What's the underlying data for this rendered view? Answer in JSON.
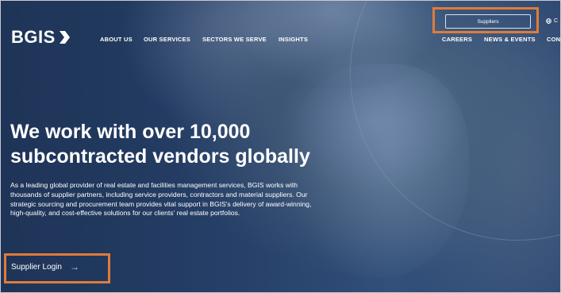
{
  "brand": {
    "logo_text": "BGIS"
  },
  "nav": {
    "items": [
      "ABOUT US",
      "OUR SERVICES",
      "SECTORS WE SERVE",
      "INSIGHTS"
    ]
  },
  "utility_nav": {
    "items": [
      "CAREERS",
      "NEWS & EVENTS",
      "CON"
    ]
  },
  "top_bar": {
    "suppliers_label": "Suppliers",
    "language_label": "C"
  },
  "hero": {
    "headline_line1": "We work with over 10,000",
    "headline_line2": "subcontracted vendors globally",
    "paragraph": "As a leading global provider of real estate and facilities management services, BGIS works with thousands of supplier partners, including service providers, contractors and material suppliers. Our strategic sourcing and procurement team provides vital support in BGIS's delivery of award-winning, high-quality, and cost-effective solutions for our clients' real estate portfolios.",
    "cta_label": "Supplier Login",
    "cta_arrow": "→"
  },
  "colors": {
    "highlight": "#e07b39",
    "background": "#2a4570",
    "text": "#ffffff"
  },
  "icons": [
    "logo-chevron-icon",
    "globe-icon",
    "arrow-right-icon"
  ]
}
